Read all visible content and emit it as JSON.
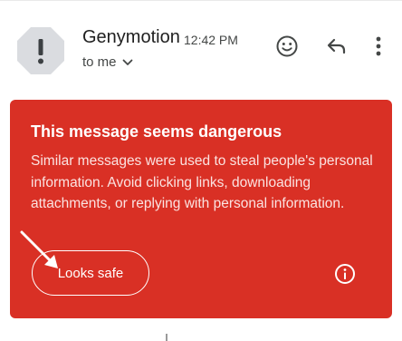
{
  "header": {
    "sender_name": "Genymotion",
    "time": "12:42 PM",
    "recipient_label": "to me",
    "avatar_icon": "exclamation-octagon-icon",
    "actions": {
      "emoji_icon": "emoji-reaction-icon",
      "reply_icon": "reply-icon",
      "more_icon": "more-vert-icon"
    }
  },
  "warning": {
    "title": "This message seems dangerous",
    "body": "Similar messages were used to steal people's personal information. Avoid clicking links, downloading attachments, or replying with personal information.",
    "safe_button_label": "Looks safe",
    "info_icon": "info-icon",
    "background_color": "#d93025"
  },
  "annotation": {
    "pointer_icon": "pointer-arrow-icon"
  }
}
